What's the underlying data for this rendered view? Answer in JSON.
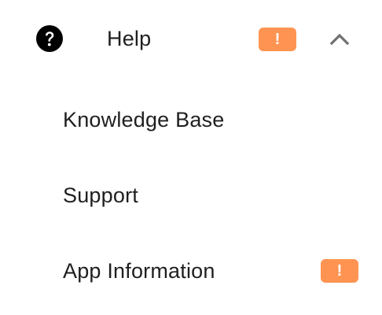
{
  "menu": {
    "header": {
      "label": "Help",
      "icon": "help-circle-icon",
      "badge": "!",
      "expanded_icon": "chevron-up-icon"
    },
    "items": [
      {
        "label": "Knowledge Base"
      },
      {
        "label": "Support"
      },
      {
        "label": "App Information",
        "badge": "!"
      }
    ]
  },
  "colors": {
    "badge": "#ff9452",
    "text": "#1f1f1f",
    "icon": "#000000",
    "chevron": "#707070"
  }
}
